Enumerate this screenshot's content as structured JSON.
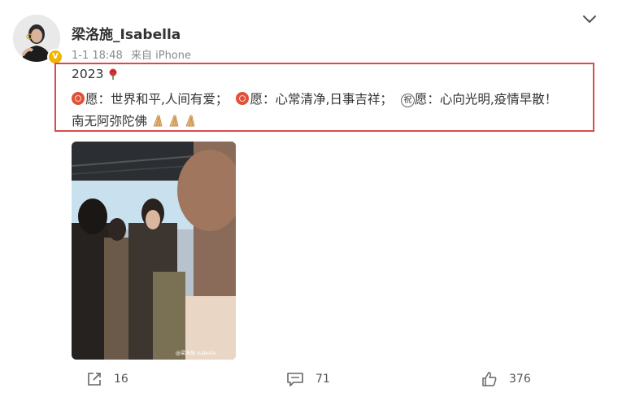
{
  "post": {
    "username": "梁洛施_Isabella",
    "verified_badge": "V",
    "time": "1-1 18:48",
    "source": "来自 iPhone",
    "year": "2023",
    "wish1": "愿：世界和平,人间有爱；",
    "wish2": "愿：心常清净,日事吉祥；",
    "wish3_char": "祝",
    "wish3": "愿：心向光明,疫情早散！",
    "line3": "南无阿弥陀佛",
    "watermark": "@梁洛施 Isabella"
  },
  "actions": {
    "share_count": "16",
    "comment_count": "71",
    "like_count": "376"
  },
  "colors": {
    "highlight_border": "#d64b4b",
    "accent_red": "#e0513a",
    "meta_gray": "#8a8a8a"
  },
  "icons": [
    "chevron-down-icon",
    "rose-icon",
    "prayer-hands-icon",
    "share-icon",
    "comment-icon",
    "like-icon"
  ]
}
